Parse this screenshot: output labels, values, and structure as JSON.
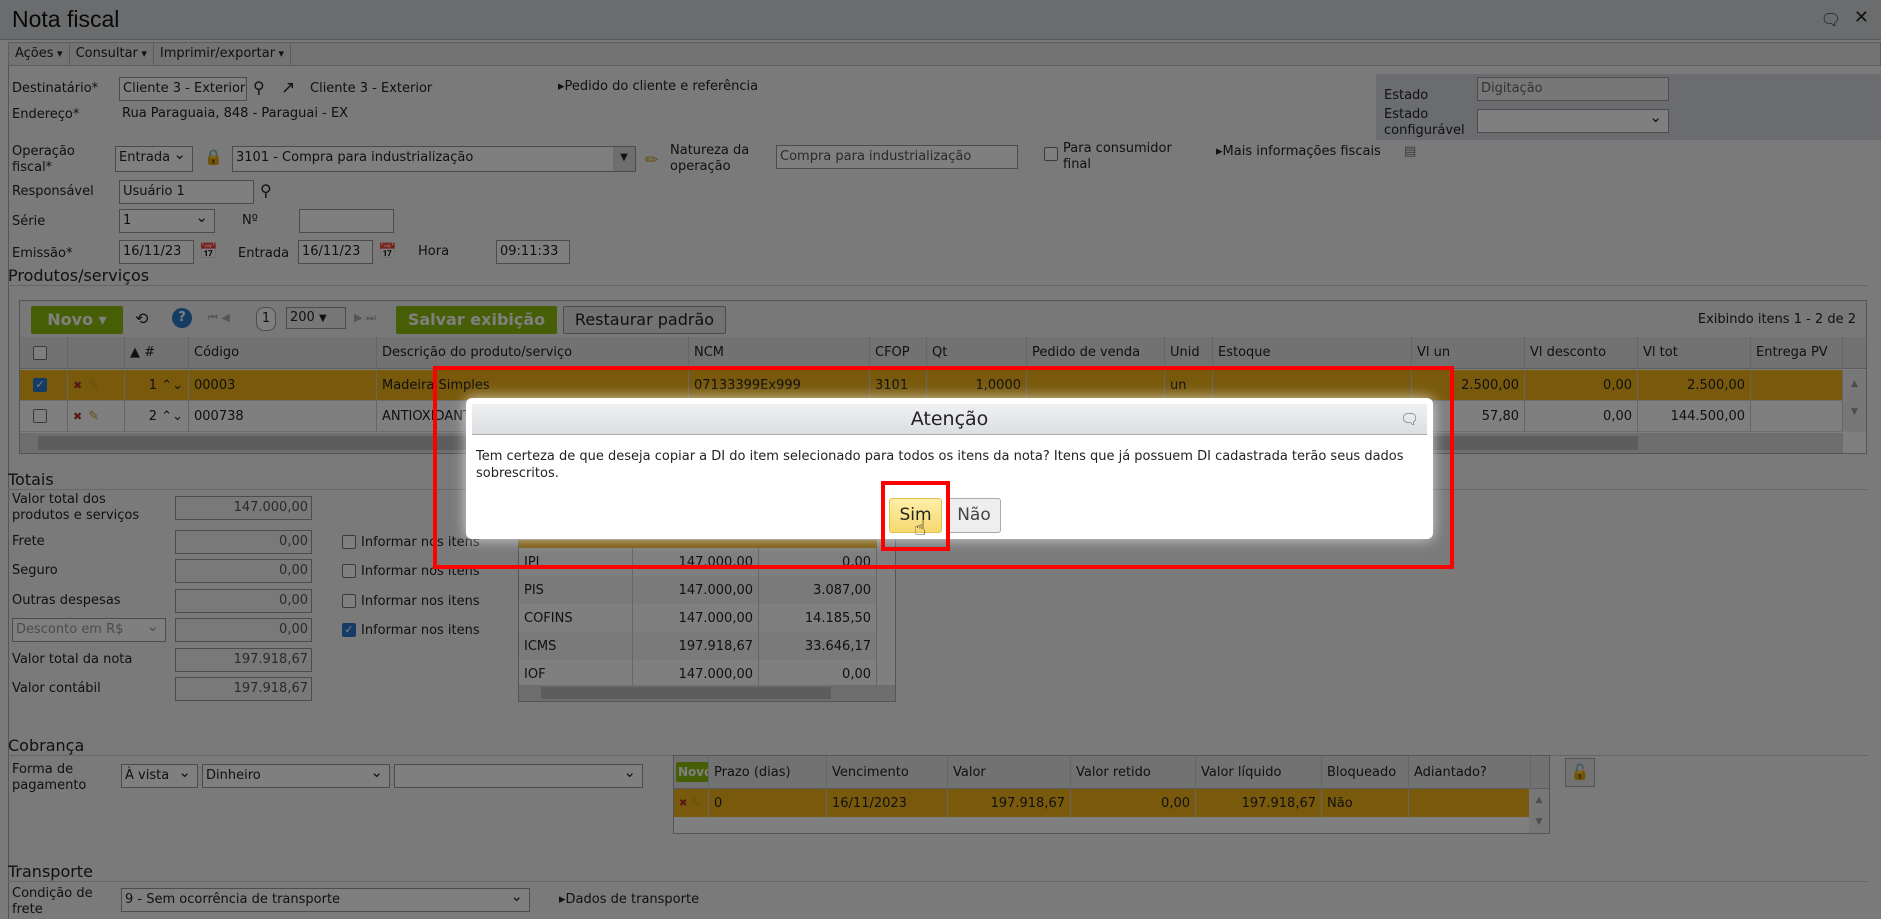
{
  "window": {
    "title": "Nota fiscal"
  },
  "menu": [
    "Ações",
    "Consultar",
    "Imprimir/exportar"
  ],
  "header": {
    "destinatario_label": "Destinatário*",
    "destinatario_value": "Cliente 3 - Exterior",
    "destinatario_link": "Cliente 3 - Exterior",
    "pedido_link": "Pedido do cliente e referência",
    "endereco_label": "Endereço*",
    "endereco_value": "Rua Paraguaia, 848 - Paraguai - EX",
    "operacao_label": "Operação fiscal*",
    "operacao_tipo": "Entrada",
    "operacao_value": "3101 - Compra para industrialização",
    "natureza_label": "Natureza da operação",
    "natureza_value": "Compra para industrialização",
    "consumidor_label": "Para consumidor final",
    "mais_info_link": "Mais informações fiscais",
    "responsavel_label": "Responsável",
    "responsavel_value": "Usuário 1",
    "serie_label": "Série",
    "serie_value": "1",
    "numero_label": "Nº",
    "numero_value": "",
    "emissao_label": "Emissão*",
    "emissao_value": "16/11/23",
    "entrada_label": "Entrada",
    "entrada_value": "16/11/23",
    "hora_label": "Hora",
    "hora_value": "09:11:33",
    "estado_label": "Estado",
    "estado_value": "Digitação",
    "estado_config_label": "Estado configurável",
    "estado_config_value": ""
  },
  "produtos": {
    "section": "Produtos/serviços",
    "novo": "Novo",
    "page": "1",
    "page_size": "200",
    "salvar": "Salvar exibição",
    "restaurar": "Restaurar padrão",
    "exibindo": "Exibindo itens 1 - 2 de 2",
    "columns": [
      "",
      "",
      "▲ #",
      "Código",
      "Descrição do produto/serviço",
      "NCM",
      "CFOP",
      "Qt",
      "Pedido de venda",
      "Unid",
      "Estoque",
      "Vl un",
      "Vl desconto",
      "Vl tot",
      "Entrega PV"
    ],
    "rows": [
      {
        "checked": true,
        "n": "1",
        "codigo": "00003",
        "descricao": "Madeira Simples",
        "ncm": "07133399Ex999",
        "cfop": "3101",
        "qt": "1,0000",
        "pedido": "",
        "unid": "un",
        "estoque": "",
        "vlun": "2.500,00",
        "desc": "0,00",
        "tot": "2.500,00",
        "entrega": ""
      },
      {
        "checked": false,
        "n": "2",
        "codigo": "000738",
        "descricao": "ANTIOXIDANTE",
        "ncm": "",
        "cfop": "",
        "qt": "",
        "pedido": "",
        "unid": "",
        "estoque": "",
        "vlun": "57,80",
        "desc": "0,00",
        "tot": "144.500,00",
        "entrega": ""
      }
    ]
  },
  "totais": {
    "section": "Totais",
    "rows": [
      {
        "label": "Valor total dos produtos e serviços",
        "value": "147.000,00"
      },
      {
        "label": "Frete",
        "value": "0,00",
        "check": false
      },
      {
        "label": "Seguro",
        "value": "0,00",
        "check": false
      },
      {
        "label": "Outras despesas",
        "value": "0,00",
        "check": false
      },
      {
        "label": "Desconto em R$",
        "value": "0,00",
        "check": true
      },
      {
        "label": "Valor total da nota",
        "value": "197.918,67"
      },
      {
        "label": "Valor contábil",
        "value": "197.918,67"
      }
    ],
    "informar_label": "Informar nos itens",
    "impostos": [
      [
        "IPI",
        "147.000,00",
        "0,00"
      ],
      [
        "PIS",
        "147.000,00",
        "3.087,00"
      ],
      [
        "COFINS",
        "147.000,00",
        "14.185,50"
      ],
      [
        "ICMS",
        "197.918,67",
        "33.646,17"
      ],
      [
        "IOF",
        "147.000,00",
        "0,00"
      ]
    ]
  },
  "cobranca": {
    "section": "Cobrança",
    "forma_label": "Forma de pagamento",
    "forma": "À vista",
    "meio": "Dinheiro",
    "extra": "",
    "novo": "Novo",
    "columns": [
      "Prazo (dias)",
      "Vencimento",
      "Valor",
      "Valor retido",
      "Valor líquido",
      "Bloqueado",
      "Adiantado?"
    ],
    "row": [
      "0",
      "16/11/2023",
      "197.918,67",
      "0,00",
      "197.918,67",
      "Não",
      ""
    ]
  },
  "transporte": {
    "section": "Transporte",
    "condicao_label": "Condição de frete",
    "condicao_value": "9 - Sem ocorrência de transporte",
    "dados_link": "Dados de transporte"
  },
  "dialog": {
    "title": "Atenção",
    "message": "Tem certeza de que deseja copiar a DI do item selecionado para todos os itens da nota? Itens que já possuem DI cadastrada terão seus dados sobrescritos.",
    "yes": "Sim",
    "no": "Não"
  },
  "colors": {
    "highlight": "#f3b418",
    "green": "#8cbf0c",
    "annotation": "#ff0000"
  }
}
